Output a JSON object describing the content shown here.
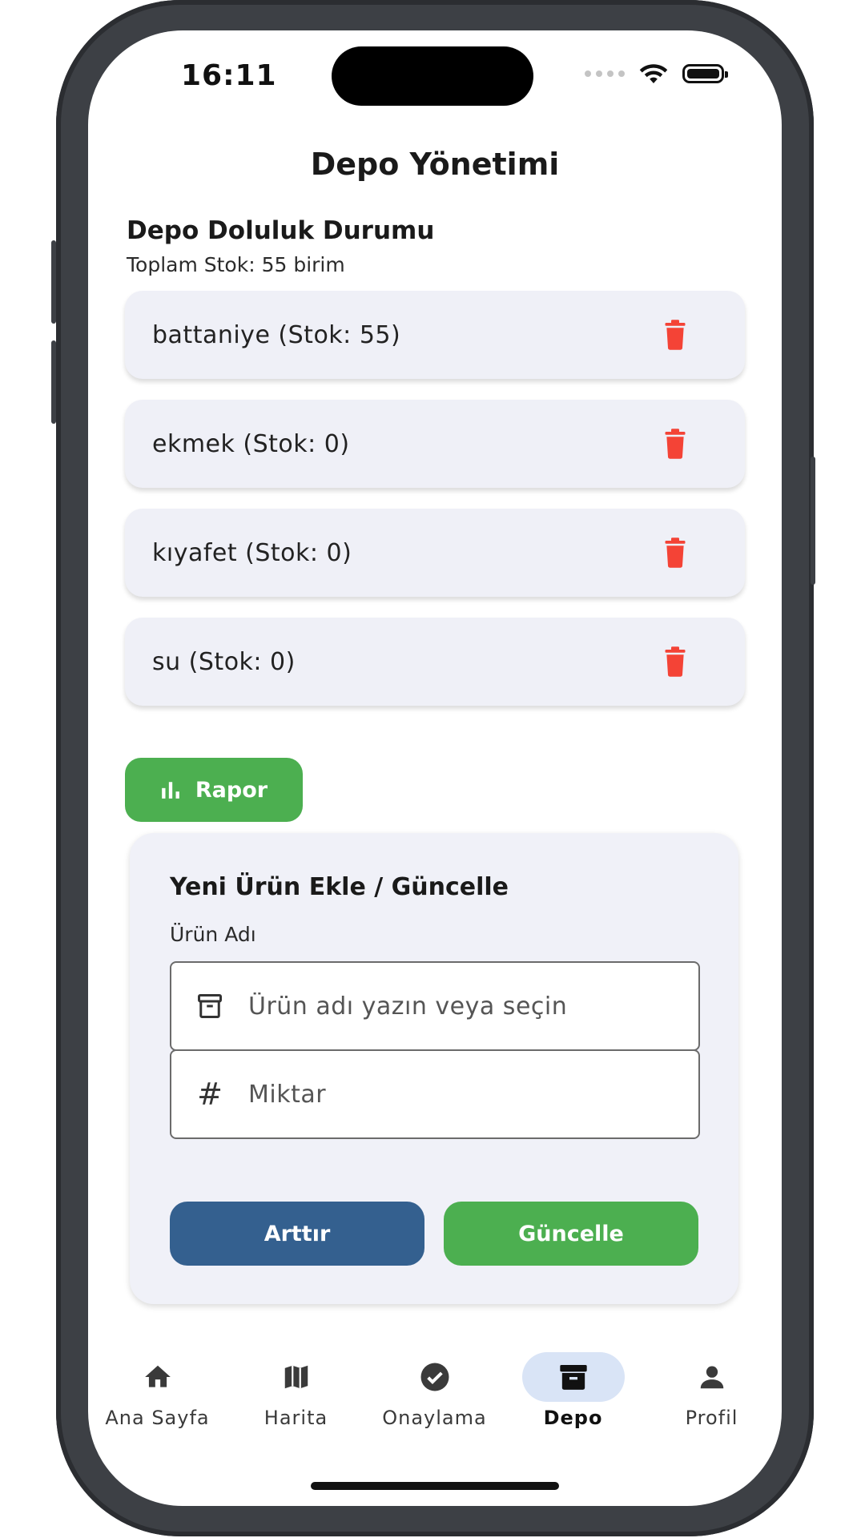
{
  "status_bar": {
    "time": "16:11"
  },
  "header": {
    "title": "Depo Yönetimi"
  },
  "occupancy": {
    "title": "Depo Doluluk Durumu",
    "total_stock": "Toplam Stok: 55 birim"
  },
  "items": [
    {
      "label": "battaniye (Stok: 55)"
    },
    {
      "label": "ekmek (Stok: 0)"
    },
    {
      "label": "kıyafet (Stok: 0)"
    },
    {
      "label": "su (Stok: 0)"
    }
  ],
  "report_button": {
    "label": "Rapor",
    "icon": "bar-chart-icon"
  },
  "form": {
    "title": "Yeni Ürün Ekle / Güncelle",
    "product_label": "Ürün Adı",
    "product_input": {
      "value": "",
      "placeholder": "Ürün adı yazın veya seçin",
      "icon": "archive-icon"
    },
    "quantity_input": {
      "value": "",
      "placeholder": "Miktar",
      "icon": "hash-icon"
    },
    "increase_label": "Arttır",
    "update_label": "Güncelle"
  },
  "bottom_nav": {
    "items": [
      {
        "label": "Ana Sayfa",
        "icon": "home-icon",
        "active": false
      },
      {
        "label": "Harita",
        "icon": "map-icon",
        "active": false
      },
      {
        "label": "Onaylama",
        "icon": "check-circle-icon",
        "active": false
      },
      {
        "label": "Depo",
        "icon": "warehouse-icon",
        "active": true
      },
      {
        "label": "Profil",
        "icon": "person-icon",
        "active": false
      }
    ]
  },
  "colors": {
    "accent_green": "#4caf50",
    "accent_blue": "#34608f",
    "danger_red": "#f44336",
    "card_bg": "#eff0f7",
    "active_nav_bg": "#d9e4f6"
  }
}
